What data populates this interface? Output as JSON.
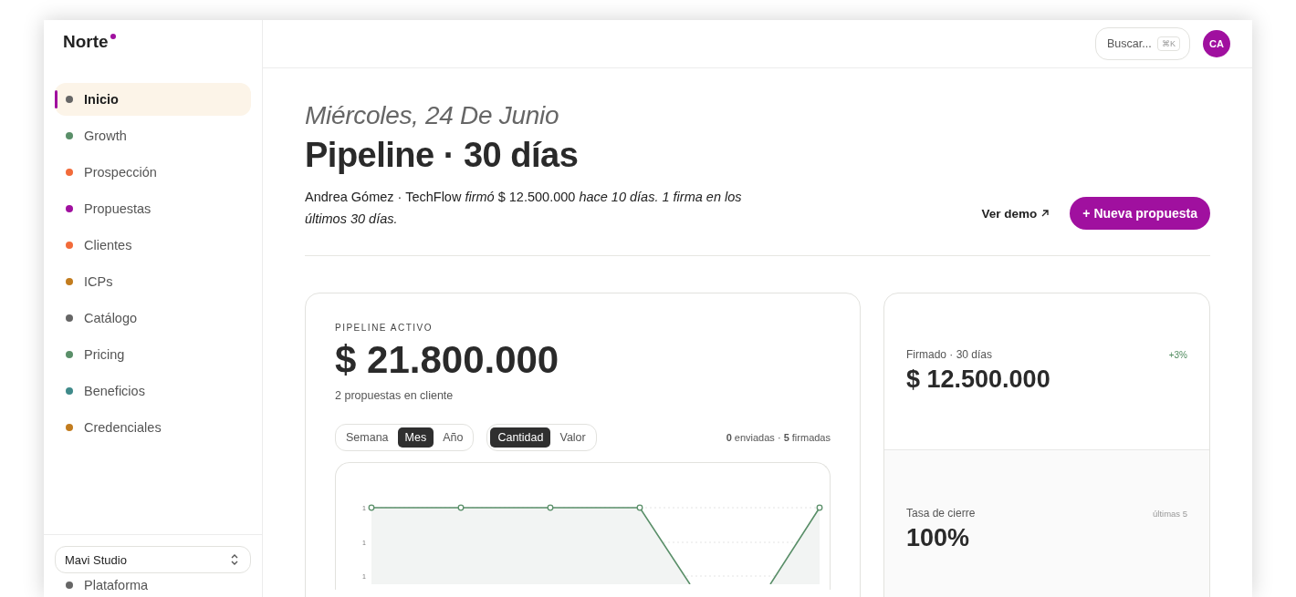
{
  "brand": {
    "name": "Norte"
  },
  "nav": [
    {
      "label": "Inicio",
      "color": "#666666",
      "selected": true
    },
    {
      "label": "Growth",
      "color": "#5a8f69",
      "selected": false
    },
    {
      "label": "Prospección",
      "color": "#f26b3a",
      "selected": false
    },
    {
      "label": "Propuestas",
      "color": "#a0109f",
      "selected": false
    },
    {
      "label": "Clientes",
      "color": "#f26b3a",
      "selected": false
    },
    {
      "label": "ICPs",
      "color": "#c27c1e",
      "selected": false
    },
    {
      "label": "Catálogo",
      "color": "#666666",
      "selected": false
    },
    {
      "label": "Pricing",
      "color": "#5a8f69",
      "selected": false
    },
    {
      "label": "Beneficios",
      "color": "#3f8a8a",
      "selected": false
    },
    {
      "label": "Credenciales",
      "color": "#c27c1e",
      "selected": false
    }
  ],
  "workspace": {
    "label": "Mavi Studio"
  },
  "nav_secondary": [
    {
      "label": "Plataforma",
      "color": "#666666"
    }
  ],
  "header": {
    "search": {
      "placeholder": "Buscar...",
      "shortcut": "⌘K"
    },
    "avatar": {
      "initials": "CA"
    }
  },
  "page": {
    "date": "Miércoles, 24 De Junio",
    "title": "Pipeline · 30 días",
    "summary": "Andrea Gómez · TechFlow *firmó* $ 12.500.000 *hace 10 días. 1 firma en los últimos 30 días.*",
    "actions": [
      {
        "label": "Ver demo",
        "kind": "link"
      },
      {
        "label": "+ Nueva propuesta",
        "kind": "primary"
      }
    ]
  },
  "pipeline": {
    "label": "PIPELINE ACTIVO",
    "amount": "$ 21.800.000",
    "subtitle": "2 propuestas en cliente",
    "period_toggle": [
      {
        "label": "Semana",
        "selected": false
      },
      {
        "label": "Mes",
        "selected": true
      },
      {
        "label": "Año",
        "selected": false
      }
    ],
    "metric_toggle": [
      {
        "label": "Cantidad",
        "selected": true
      },
      {
        "label": "Valor",
        "selected": false
      }
    ],
    "counts": "**0** enviadas · **5** firmadas",
    "chart": {
      "y_tick_labels": [
        "1",
        "1",
        "1"
      ]
    }
  },
  "stats": [
    {
      "label": "Firmado · 30 días",
      "value": "$ 12.500.000",
      "delta": "+3%"
    },
    {
      "label": "Tasa de cierre",
      "value": "100%",
      "note": "últimas 5"
    }
  ]
}
